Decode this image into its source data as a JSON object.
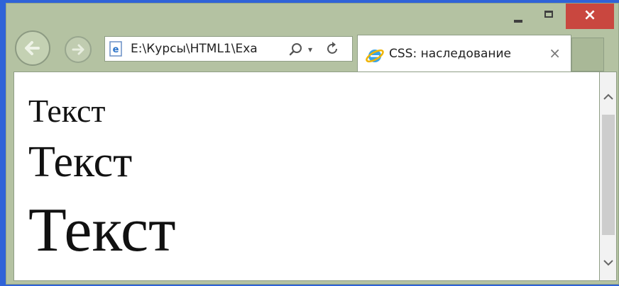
{
  "window": {
    "controls": {
      "minimize_icon": "minimize-icon",
      "maximize_icon": "maximize-icon",
      "close_glyph": "×"
    }
  },
  "navigation": {
    "back_icon": "arrow-left-icon",
    "forward_icon": "arrow-right-icon"
  },
  "address_bar": {
    "page_icon": "ie-page-icon",
    "value": "E:\\Курсы\\HTML1\\Exa",
    "search_icon": "search-icon",
    "dropdown_icon": "dropdown-icon",
    "refresh_icon": "refresh-icon"
  },
  "tab": {
    "icon": "ie-logo-icon",
    "title": "CSS: наследование",
    "close_glyph": "×"
  },
  "page": {
    "lines": [
      "Текст",
      "Текст",
      "Текст"
    ]
  },
  "colors": {
    "background": "#2f63d8",
    "chrome": "#b4c2a2",
    "close_button": "#c9473f"
  }
}
